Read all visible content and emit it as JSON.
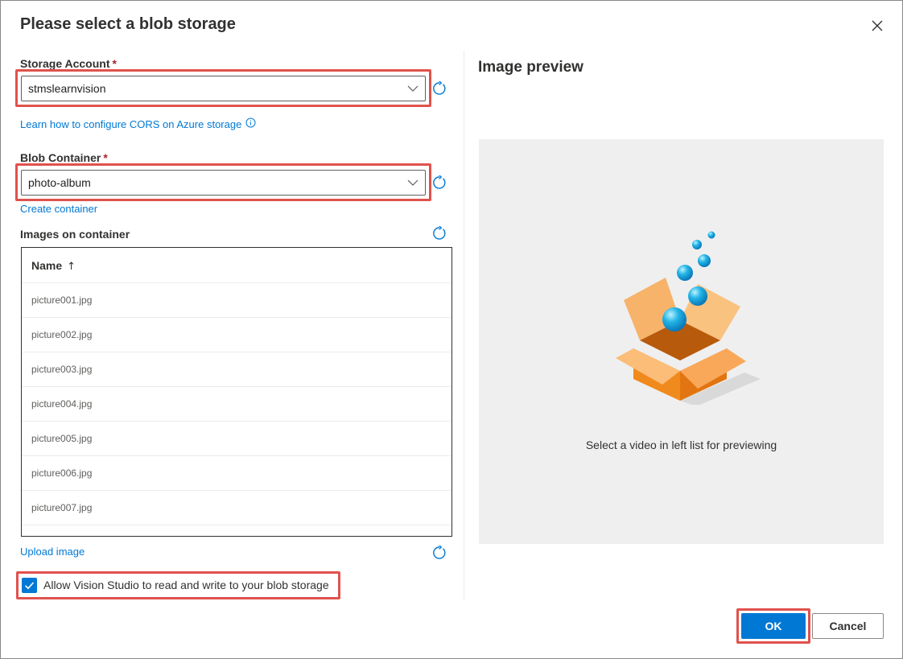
{
  "dialog": {
    "title": "Please select a blob storage",
    "close_icon": "close-icon"
  },
  "storage_account": {
    "label": "Storage Account",
    "required_marker": "*",
    "value": "stmslearnvision",
    "cors_link": "Learn how to configure CORS on Azure storage"
  },
  "blob_container": {
    "label": "Blob Container",
    "required_marker": "*",
    "value": "photo-album",
    "create_link": "Create container"
  },
  "images": {
    "label": "Images on container",
    "column_header": "Name",
    "sort_indicator": "↑",
    "rows": [
      "picture001.jpg",
      "picture002.jpg",
      "picture003.jpg",
      "picture004.jpg",
      "picture005.jpg",
      "picture006.jpg",
      "picture007.jpg"
    ],
    "upload_link": "Upload image"
  },
  "consent": {
    "label": "Allow Vision Studio to read and write to your blob storage",
    "checked": true
  },
  "preview": {
    "title": "Image preview",
    "empty_message": "Select a video in left list for previewing",
    "illustration": "empty-box-illustration"
  },
  "actions": {
    "ok_label": "OK",
    "cancel_label": "Cancel"
  },
  "colors": {
    "accent": "#0078d4",
    "highlight": "#e0524d",
    "required": "#a4262c",
    "preview_bg": "#efefef"
  }
}
